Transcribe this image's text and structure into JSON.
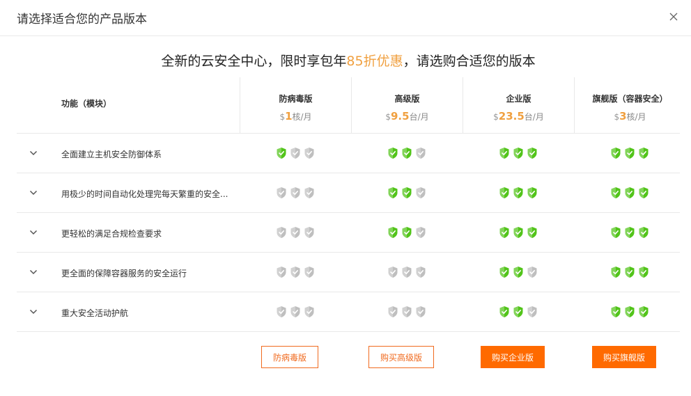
{
  "dialog": {
    "title": "请选择适合您的产品版本",
    "close_icon": "close-icon"
  },
  "headline": {
    "prefix": "全新的云安全中心，限时享包年",
    "highlight": "85折优惠",
    "suffix": "，请选购合适您的版本"
  },
  "colors": {
    "accent": "#ff6a00",
    "price": "#f0a040",
    "shield_active": "#52c41a",
    "shield_inactive": "#bfbfbf"
  },
  "table": {
    "feature_header": "功能（模块）",
    "plans": [
      {
        "name": "防病毒版",
        "currency": "$",
        "price": "1",
        "unit": "核/月"
      },
      {
        "name": "高级版",
        "currency": "$",
        "price": "9.5",
        "unit": "台/月"
      },
      {
        "name": "企业版",
        "currency": "$",
        "price": "23.5",
        "unit": "台/月"
      },
      {
        "name": "旗舰版（容器安全）",
        "currency": "$",
        "price": "3",
        "unit": "核/月"
      }
    ],
    "rows": [
      {
        "label": "全面建立主机安全防御体系",
        "levels": [
          1,
          2,
          3,
          3
        ]
      },
      {
        "label": "用极少的时间自动化处理完每天繁重的安全...",
        "levels": [
          0,
          2,
          3,
          3
        ]
      },
      {
        "label": "更轻松的满足合规检查要求",
        "levels": [
          0,
          2,
          3,
          3
        ]
      },
      {
        "label": "更全面的保障容器服务的安全运行",
        "levels": [
          0,
          0,
          2,
          3
        ]
      },
      {
        "label": "重大安全活动护航",
        "levels": [
          0,
          0,
          2,
          3
        ]
      }
    ]
  },
  "buttons": {
    "antivirus": "防病毒版",
    "advanced": "购买高级版",
    "enterprise": "购买企业版",
    "flagship": "购买旗舰版"
  }
}
